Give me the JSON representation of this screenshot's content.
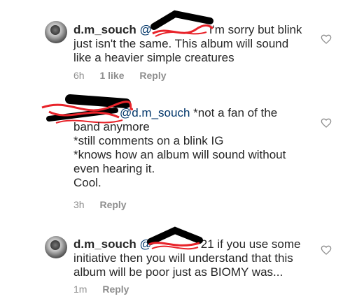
{
  "comments": [
    {
      "username": "d.m_souch",
      "mention": "@",
      "text_lines": [
        "I'm sorry but blink",
        "just isn't the same. This album will sound",
        "like a heavier simple creatures"
      ],
      "time": "6h",
      "likes": "1 like",
      "reply": "Reply"
    },
    {
      "username": "",
      "mention": "@d.m_souch",
      "text_lines": [
        "*not a fan of the",
        "band anymore",
        "*still comments on a blink IG",
        "*knows how an album will sound without",
        "even hearing it.",
        "Cool."
      ],
      "time": "3h",
      "reply": "Reply"
    },
    {
      "username": "d.m_souch",
      "mention": "@",
      "mention_suffix": "21",
      "text_lines": [
        "if you use some",
        "initiative then you will understand that this",
        "album will be poor just as BIOMY was..."
      ],
      "time": "1m",
      "reply": "Reply"
    }
  ],
  "colors": {
    "text": "#262626",
    "meta": "#8e8e8e",
    "mention": "#003569",
    "redaction_black": "#000000",
    "redaction_red": "#e8232a"
  },
  "icons": {
    "like": "heart-outline-icon",
    "avatar": "profile-avatar"
  }
}
